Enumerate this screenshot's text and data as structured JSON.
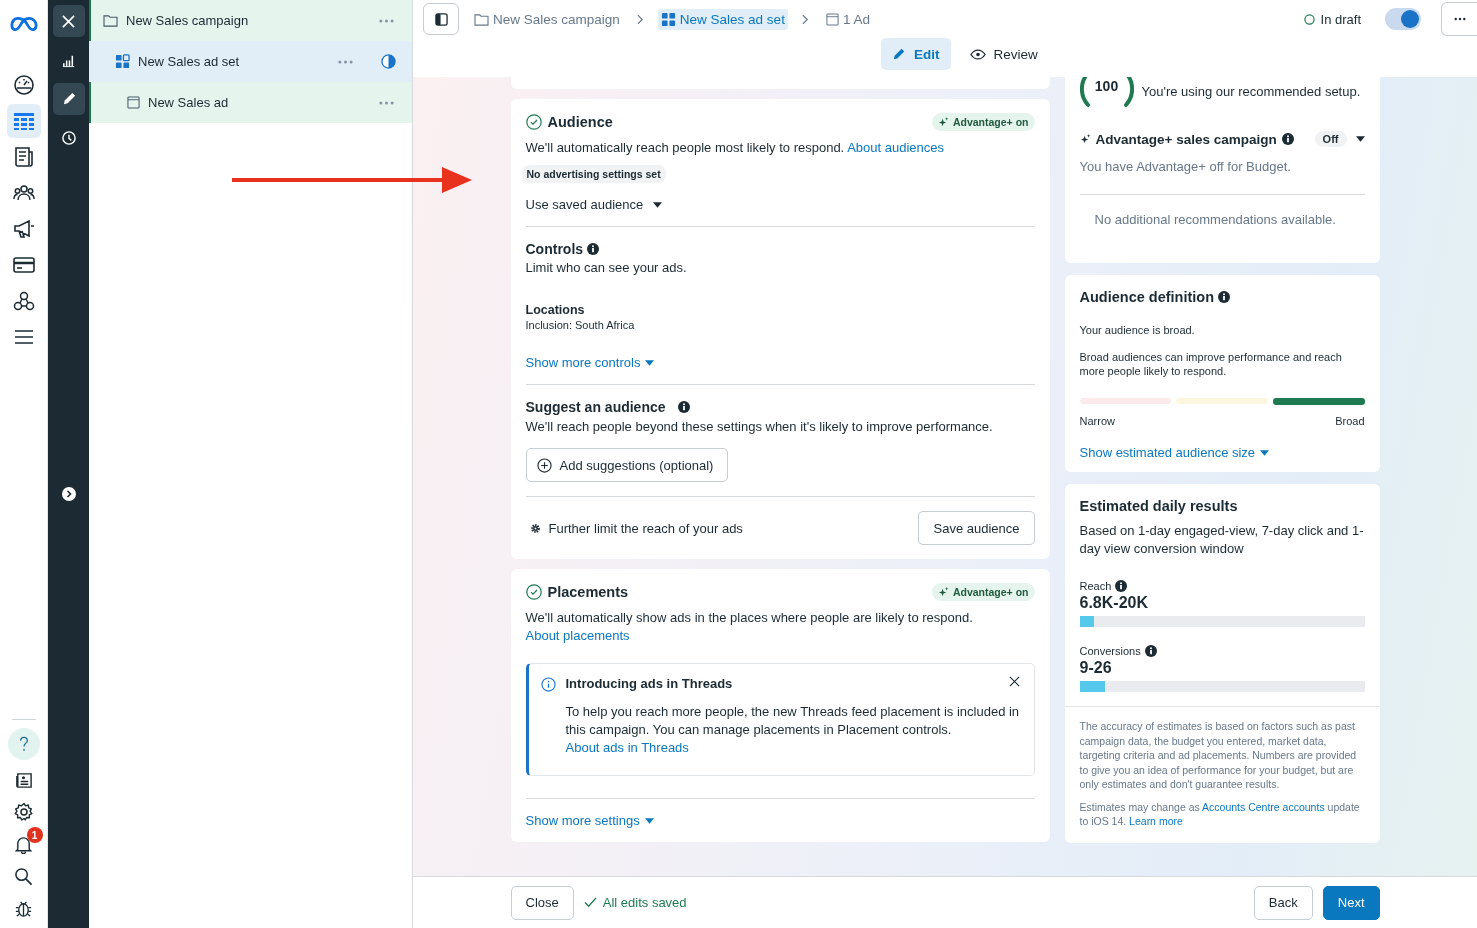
{
  "nav_rail": [
    {
      "selected": false
    },
    {
      "selected": true
    },
    {
      "selected": false
    },
    {
      "selected": false
    },
    {
      "selected": false
    },
    {
      "selected": false
    },
    {
      "selected": false
    },
    {
      "selected": false
    }
  ],
  "notification_count": "1",
  "tool_rail": [
    {
      "selected": false
    },
    {
      "selected": true
    },
    {
      "selected": false
    }
  ],
  "tree": [
    {
      "label": "New Sales campaign",
      "selected": false,
      "progress_icon": false,
      "children": [
        {
          "label": "New Sales ad set",
          "selected": true,
          "progress_icon": true,
          "children": [
            {
              "label": "New Sales ad",
              "selected": false,
              "progress_icon": false
            }
          ]
        }
      ]
    }
  ],
  "breadcrumbs": [
    {
      "label": "New Sales campaign",
      "selected": false
    },
    {
      "label": "New Sales ad set",
      "selected": true
    },
    {
      "label": "1 Ad",
      "selected": false
    }
  ],
  "status": {
    "label": "In draft",
    "toggle_on": true
  },
  "mode_tabs": [
    {
      "label": "Edit",
      "selected": true
    },
    {
      "label": "Review",
      "selected": false
    }
  ],
  "audience": {
    "title": "Audience",
    "badge": "Advantage+ on",
    "description": [
      {
        "text": "We'll automatically reach people most likely to respond. ",
        "link": false
      },
      {
        "text": "About audiences",
        "link": true
      }
    ],
    "settings_tag": "No advertising settings set",
    "saved_audience": "Use saved audience",
    "controls": {
      "title": "Controls",
      "description": "Limit who can see your ads.",
      "locations_label": "Locations",
      "locations_value": "Inclusion: South Africa",
      "show_more": "Show more controls"
    },
    "suggest": {
      "title": "Suggest an audience",
      "description": "We'll reach people beyond these settings when it's likely to improve performance.",
      "button": "Add suggestions (optional)"
    },
    "further_limit": {
      "text": "Further limit the reach of your ads",
      "button": "Save audience"
    }
  },
  "placements": {
    "title": "Placements",
    "badge": "Advantage+ on",
    "description": [
      {
        "text": "We'll automatically show ads in the places where people are likely to respond. ",
        "link": false
      },
      {
        "text": "About placements",
        "link": true
      }
    ],
    "notice": {
      "title": "Introducing ads in Threads",
      "body": [
        {
          "text": "To help you reach more people, the new Threads feed placement is included in this campaign. You can manage placements in Placement controls. ",
          "link": false
        },
        {
          "text": "About ads in Threads",
          "link": true
        }
      ]
    },
    "show_more": "Show more settings"
  },
  "score": {
    "value": "100",
    "text": "You're using our recommended setup.",
    "advantage_title": "Advantage+ sales campaign",
    "advantage_value": "Off",
    "advantage_note": "You have Advantage+ off for Budget.",
    "recommendations": "No additional recommendations available."
  },
  "audience_definition": {
    "title": "Audience definition",
    "summary": "Your audience is broad.",
    "detail": "Broad audiences can improve performance and reach more people likely to respond.",
    "segments": [
      {
        "color": "#fde8ea",
        "selected": false
      },
      {
        "color": "#fdf5dc",
        "selected": false
      },
      {
        "color": "#1f7a52",
        "selected": true
      }
    ],
    "low_label": "Narrow",
    "high_label": "Broad",
    "link": "Show estimated audience size"
  },
  "estimates": {
    "title": "Estimated daily results",
    "subtitle": "Based on 1-day engaged-view, 7-day click and 1-day view conversion window",
    "metrics": [
      {
        "label": "Reach",
        "value": "6.8K-20K",
        "level": 0.05
      },
      {
        "label": "Conversions",
        "value": "9-26",
        "level": 0.09
      }
    ],
    "disclaimer": "The accuracy of estimates is based on factors such as past campaign data, the budget you entered, market data, targeting criteria and ad placements. Numbers are provided to give you an idea of performance for your budget, but are only estimates and don't guarantee results.",
    "note": [
      {
        "text": "Estimates may change as ",
        "link": false
      },
      {
        "text": "Accounts Centre accounts",
        "link": true
      },
      {
        "text": " update to iOS 14. ",
        "link": false
      },
      {
        "text": "Learn more",
        "link": true
      }
    ]
  },
  "footer": {
    "close": "Close",
    "saved": "All edits saved",
    "back": "Back",
    "next": "Next"
  }
}
